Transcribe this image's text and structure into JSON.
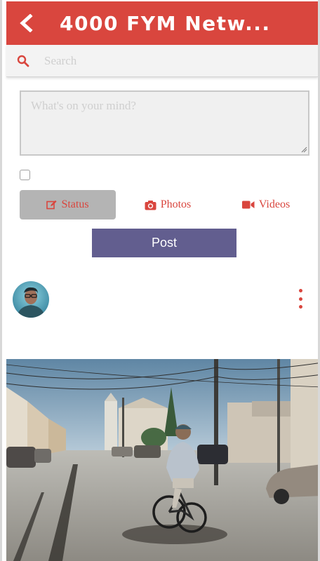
{
  "header": {
    "title": "4000 FYM Netw...",
    "back_icon": "chevron-left-icon",
    "background_color": "#d9463e"
  },
  "search": {
    "placeholder": "Search",
    "icon": "search-icon"
  },
  "composer": {
    "placeholder": "What's on your mind?",
    "tabs": [
      {
        "label": "Status",
        "icon": "edit-icon",
        "active": true
      },
      {
        "label": "Photos",
        "icon": "camera-icon",
        "active": false
      },
      {
        "label": "Videos",
        "icon": "video-camera-icon",
        "active": false
      }
    ],
    "post_label": "Post",
    "accent_color": "#d9463e",
    "post_button_color": "#625e8f"
  },
  "feed": {
    "post": {
      "avatar": "user-avatar",
      "menu_icon": "more-vertical-icon",
      "image": "cyclist-city-street-photo"
    }
  }
}
